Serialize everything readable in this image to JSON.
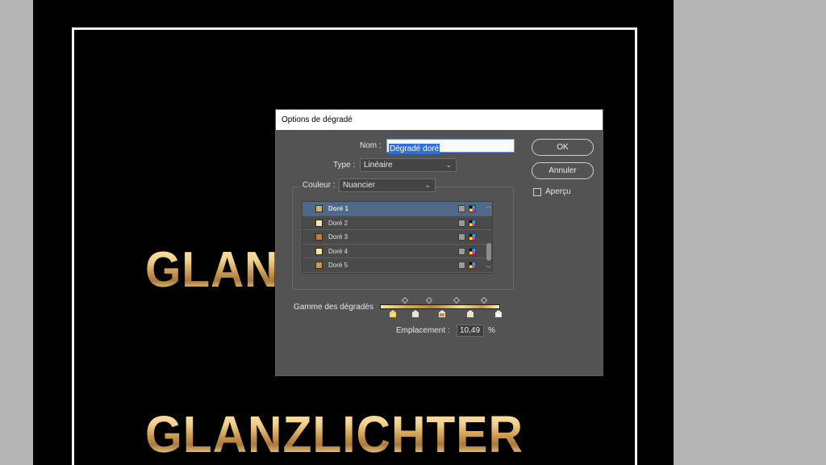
{
  "canvas": {
    "gold_text_top": "GLAN",
    "gold_text_bottom": "GLANZLICHTER"
  },
  "dialog": {
    "title": "Options de dégradé",
    "name_label": "Nom :",
    "name_value": "Dégradé doré",
    "type_label": "Type :",
    "type_value": "Linéaire",
    "color_label": "Couleur :",
    "color_value": "Nuancier",
    "ok_label": "OK",
    "cancel_label": "Annuler",
    "preview_label": "Aperçu",
    "preview_checked": false,
    "swatches": [
      {
        "name": "Doré 1",
        "color": "#d9b35f",
        "selected": true
      },
      {
        "name": "Doré 2",
        "color": "#f8e6b0",
        "selected": false
      },
      {
        "name": "Doré 3",
        "color": "#b58636",
        "selected": false
      },
      {
        "name": "Doré 4",
        "color": "#f5e2a7",
        "selected": false
      },
      {
        "name": "Doré 5",
        "color": "#d29a40",
        "selected": false
      }
    ],
    "ramp_label": "Gamme des dégradés",
    "stop_colors": [
      "#f3d793",
      "#f8e6b0",
      "#c79240",
      "#f5e2a7",
      "#ffffff"
    ],
    "location_label": "Emplacement :",
    "location_value": "10,49",
    "location_unit": "%"
  },
  "icons": {
    "chevron": "chevron-down-icon",
    "gray_swatch_mode": "grayscale-icon",
    "cmyk_swatch_mode": "cmyk-icon"
  }
}
